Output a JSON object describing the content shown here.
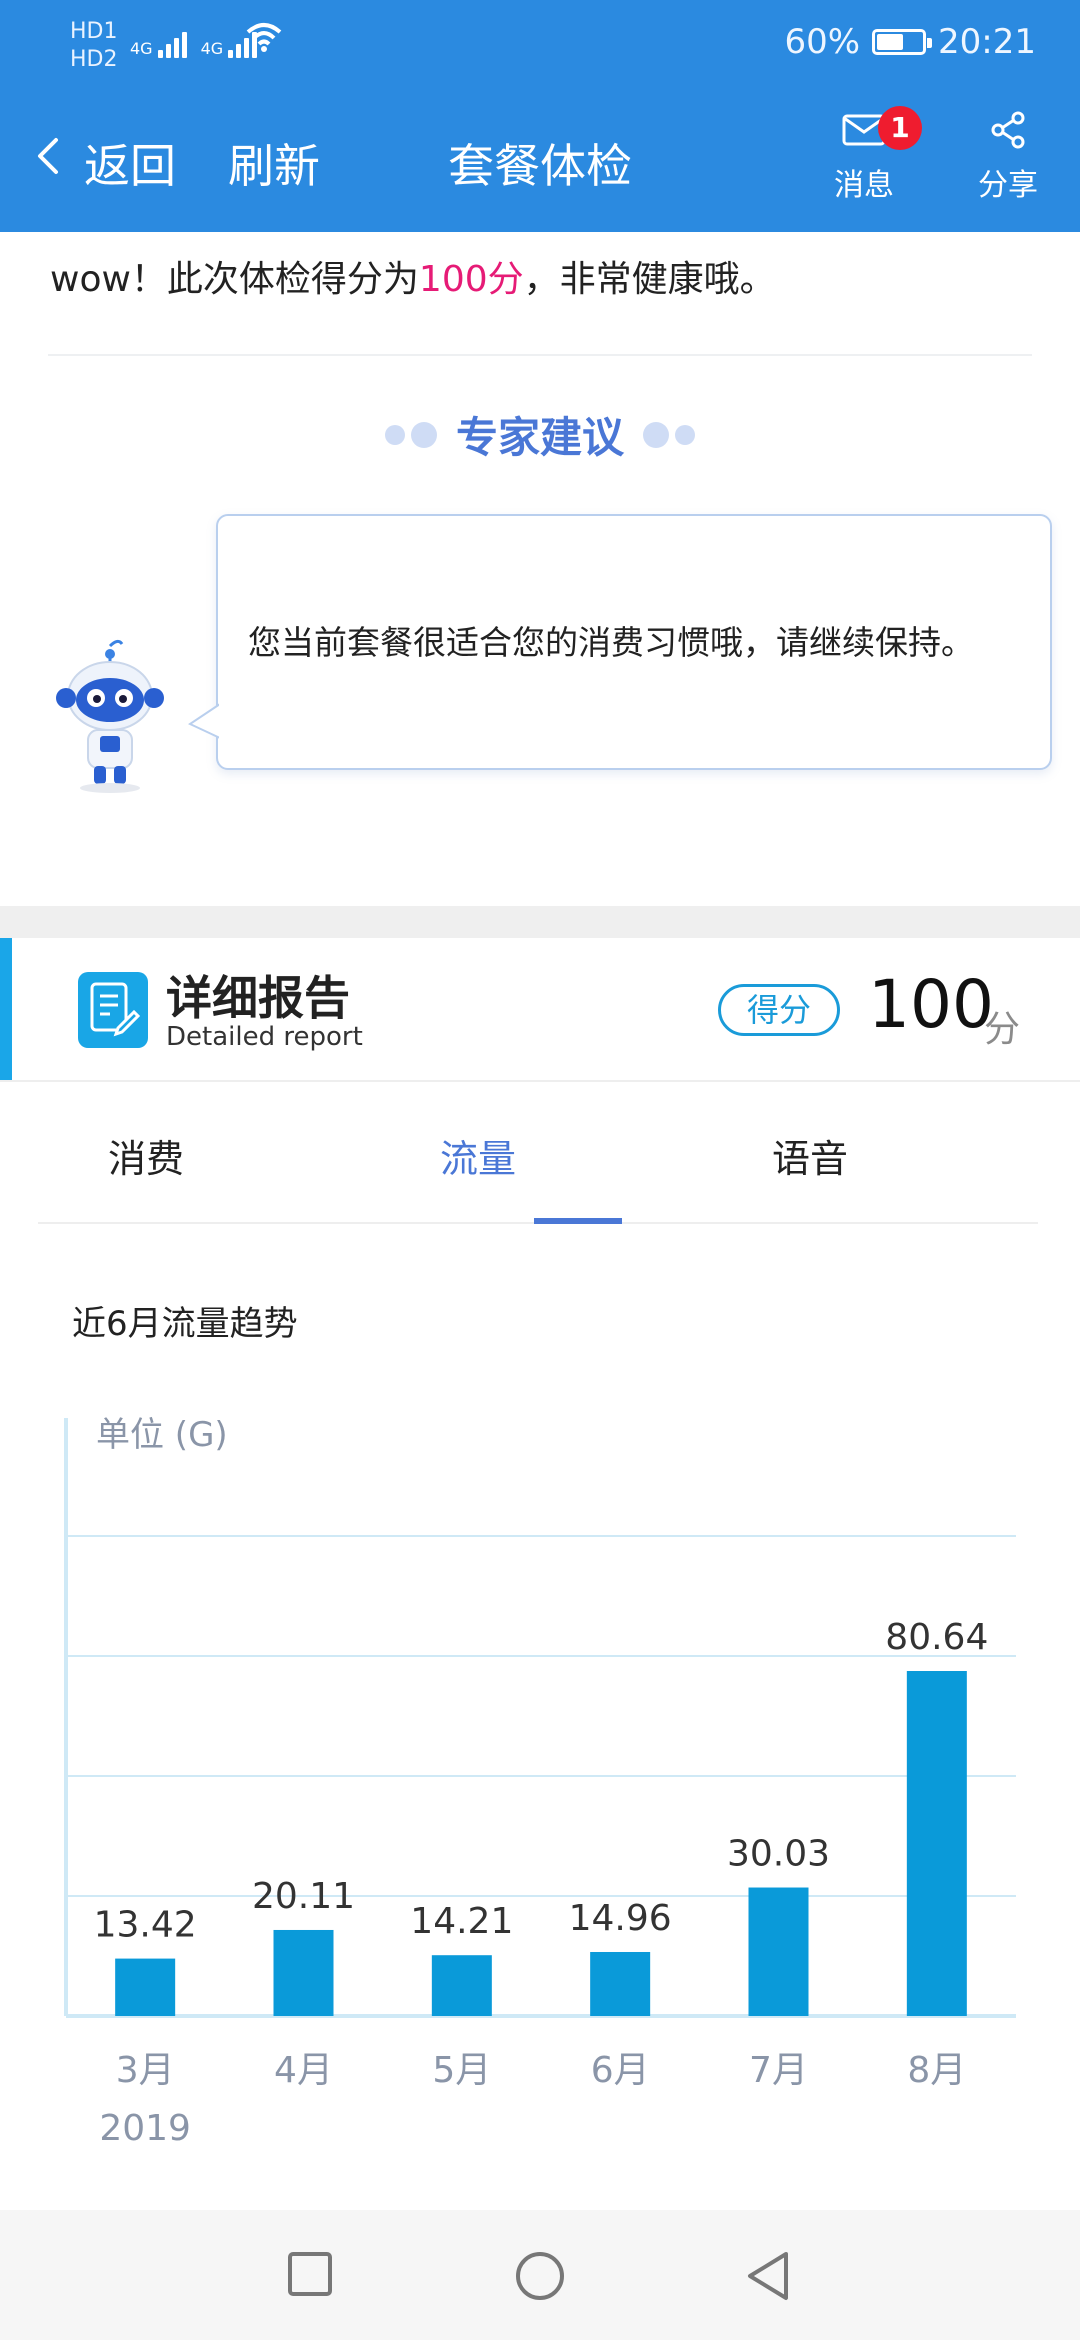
{
  "status_bar": {
    "sim": "HD",
    "network_1": "4G",
    "network_2": "4G",
    "battery_percent_label": "60%",
    "battery_level": 0.6,
    "time": "20:21"
  },
  "header": {
    "back_label": "返回",
    "refresh_label": "刷新",
    "title": "套餐体检",
    "messages_label": "消息",
    "messages_badge": "1",
    "share_label": "分享"
  },
  "result": {
    "prefix": "wow！此次体检得分为",
    "score_text": "100分",
    "suffix": "，非常健康哦。"
  },
  "expert": {
    "title": "专家建议",
    "advice": "您当前套餐很适合您的消费习惯哦，请继续保持。"
  },
  "report": {
    "title": "详细报告",
    "subtitle": "Detailed report",
    "score_pill": "得分",
    "score": "100",
    "score_unit": "分"
  },
  "tabs": [
    {
      "label": "消费",
      "active": false
    },
    {
      "label": "流量",
      "active": true
    },
    {
      "label": "语音",
      "active": false
    }
  ],
  "trend_title": "近6月流量趋势",
  "chart_data": {
    "type": "bar",
    "unit_label": "单位 (G)",
    "categories": [
      "3月",
      "4月",
      "5月",
      "6月",
      "7月",
      "8月"
    ],
    "year_label": "2019",
    "values": [
      13.42,
      20.11,
      14.21,
      14.96,
      30.03,
      80.64
    ],
    "value_labels": [
      "13.42",
      "20.11",
      "14.21",
      "14.96",
      "30.03",
      "80.64"
    ],
    "ylim": [
      0,
      125
    ],
    "grid": true,
    "bar_color": "#0a9ad9",
    "grid_color": "#cfe9f6"
  },
  "colors": {
    "header_bg": "#2b8ae0",
    "accent_blue": "#4a77d6",
    "highlight_pink": "#e61b76",
    "badge_red": "#ef1c2f"
  }
}
